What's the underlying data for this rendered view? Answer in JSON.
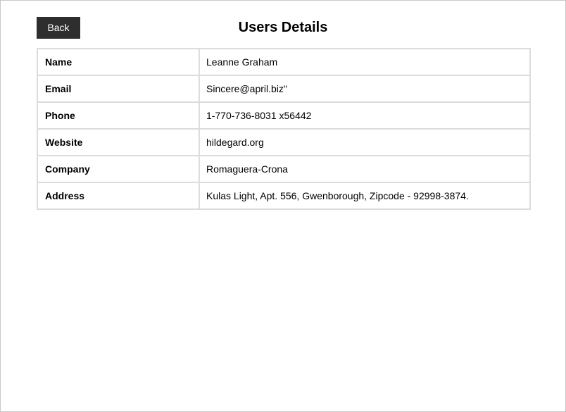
{
  "header": {
    "back_label": "Back",
    "title": "Users Details"
  },
  "details": [
    {
      "label": "Name",
      "value": "Leanne Graham"
    },
    {
      "label": "Email",
      "value": "Sincere@april.biz\""
    },
    {
      "label": "Phone",
      "value": "1-770-736-8031 x56442"
    },
    {
      "label": "Website",
      "value": "hildegard.org"
    },
    {
      "label": "Company",
      "value": "Romaguera-Crona"
    },
    {
      "label": "Address",
      "value": "Kulas Light, Apt. 556, Gwenborough, Zipcode - 92998-3874."
    }
  ],
  "colors": {
    "button_bg": "#2e2e2e",
    "button_text": "#ffffff",
    "table_border": "#dcdcdc"
  }
}
